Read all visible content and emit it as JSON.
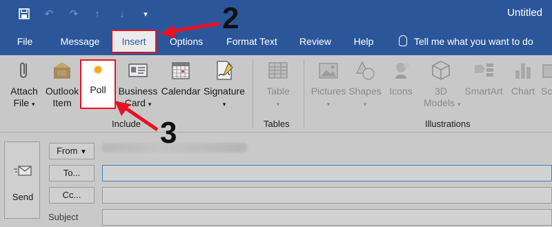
{
  "window": {
    "title": "Untitled"
  },
  "qat": [
    "save-icon",
    "undo-icon",
    "redo-icon",
    "up-arrow-icon",
    "down-arrow-icon",
    "customize-icon"
  ],
  "tabs": [
    {
      "label": "File"
    },
    {
      "label": "Message"
    },
    {
      "label": "Insert",
      "active": true
    },
    {
      "label": "Options"
    },
    {
      "label": "Format Text"
    },
    {
      "label": "Review"
    },
    {
      "label": "Help"
    }
  ],
  "tell_me": "Tell me what you want to do",
  "ribbon": {
    "include": {
      "label": "Include",
      "attach_file": {
        "line1": "Attach",
        "line2": "File"
      },
      "outlook_item": {
        "line1": "Outlook",
        "line2": "Item"
      },
      "poll": "Poll",
      "business_card": {
        "line1": "Business",
        "line2": "Card"
      },
      "calendar": "Calendar",
      "signature": "Signature"
    },
    "tables": {
      "label": "Tables",
      "table": "Table"
    },
    "illustrations": {
      "label": "Illustrations",
      "pictures": "Pictures",
      "shapes": "Shapes",
      "icons": "Icons",
      "models": {
        "line1": "3D",
        "line2": "Models"
      },
      "smartart": "SmartArt",
      "chart": "Chart",
      "screenshot": "Sc"
    }
  },
  "compose": {
    "send": "Send",
    "from": "From",
    "to": "To...",
    "cc": "Cc...",
    "subject": "Subject"
  },
  "annotations": {
    "step2": "2",
    "step3": "3"
  },
  "colors": {
    "ribbon_blue": "#2b579a",
    "highlight_red": "#e81123",
    "poll_dot": "#f4a61a"
  }
}
